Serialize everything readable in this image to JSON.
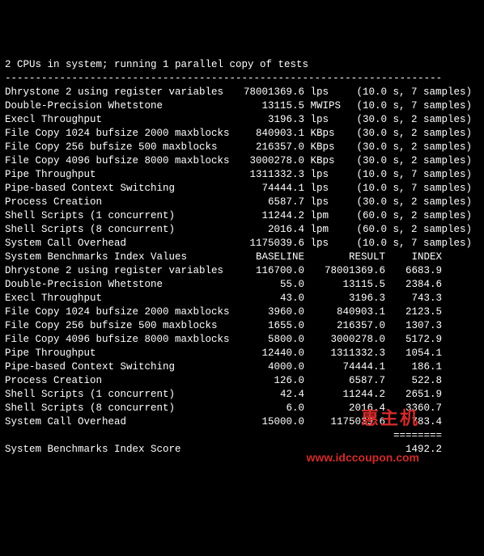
{
  "header": "2 CPUs in system; running 1 parallel copy of tests",
  "dashes": "------------------------------------------------------------------------",
  "tests": [
    {
      "name": "Dhrystone 2 using register variables",
      "value": "78001369.6",
      "unit": "lps",
      "timing": "(10.0 s, 7 samples)"
    },
    {
      "name": "Double-Precision Whetstone",
      "value": "13115.5",
      "unit": "MWIPS",
      "timing": "(10.0 s, 7 samples)"
    },
    {
      "name": "Execl Throughput",
      "value": "3196.3",
      "unit": "lps",
      "timing": "(30.0 s, 2 samples)"
    },
    {
      "name": "File Copy 1024 bufsize 2000 maxblocks",
      "value": "840903.1",
      "unit": "KBps",
      "timing": "(30.0 s, 2 samples)"
    },
    {
      "name": "File Copy 256 bufsize 500 maxblocks",
      "value": "216357.0",
      "unit": "KBps",
      "timing": "(30.0 s, 2 samples)"
    },
    {
      "name": "File Copy 4096 bufsize 8000 maxblocks",
      "value": "3000278.0",
      "unit": "KBps",
      "timing": "(30.0 s, 2 samples)"
    },
    {
      "name": "Pipe Throughput",
      "value": "1311332.3",
      "unit": "lps",
      "timing": "(10.0 s, 7 samples)"
    },
    {
      "name": "Pipe-based Context Switching",
      "value": "74444.1",
      "unit": "lps",
      "timing": "(10.0 s, 7 samples)"
    },
    {
      "name": "Process Creation",
      "value": "6587.7",
      "unit": "lps",
      "timing": "(30.0 s, 2 samples)"
    },
    {
      "name": "Shell Scripts (1 concurrent)",
      "value": "11244.2",
      "unit": "lpm",
      "timing": "(60.0 s, 2 samples)"
    },
    {
      "name": "Shell Scripts (8 concurrent)",
      "value": "2016.4",
      "unit": "lpm",
      "timing": "(60.0 s, 2 samples)"
    },
    {
      "name": "System Call Overhead",
      "value": "1175039.6",
      "unit": "lps",
      "timing": "(10.0 s, 7 samples)"
    }
  ],
  "index_header": {
    "name": "System Benchmarks Index Values",
    "baseline": "BASELINE",
    "result": "RESULT",
    "index": "INDEX"
  },
  "index": [
    {
      "name": "Dhrystone 2 using register variables",
      "baseline": "116700.0",
      "result": "78001369.6",
      "index": "6683.9"
    },
    {
      "name": "Double-Precision Whetstone",
      "baseline": "55.0",
      "result": "13115.5",
      "index": "2384.6"
    },
    {
      "name": "Execl Throughput",
      "baseline": "43.0",
      "result": "3196.3",
      "index": "743.3"
    },
    {
      "name": "File Copy 1024 bufsize 2000 maxblocks",
      "baseline": "3960.0",
      "result": "840903.1",
      "index": "2123.5"
    },
    {
      "name": "File Copy 256 bufsize 500 maxblocks",
      "baseline": "1655.0",
      "result": "216357.0",
      "index": "1307.3"
    },
    {
      "name": "File Copy 4096 bufsize 8000 maxblocks",
      "baseline": "5800.0",
      "result": "3000278.0",
      "index": "5172.9"
    },
    {
      "name": "Pipe Throughput",
      "baseline": "12440.0",
      "result": "1311332.3",
      "index": "1054.1"
    },
    {
      "name": "Pipe-based Context Switching",
      "baseline": "4000.0",
      "result": "74444.1",
      "index": "186.1"
    },
    {
      "name": "Process Creation",
      "baseline": "126.0",
      "result": "6587.7",
      "index": "522.8"
    },
    {
      "name": "Shell Scripts (1 concurrent)",
      "baseline": "42.4",
      "result": "11244.2",
      "index": "2651.9"
    },
    {
      "name": "Shell Scripts (8 concurrent)",
      "baseline": "6.0",
      "result": "2016.4",
      "index": "3360.7"
    },
    {
      "name": "System Call Overhead",
      "baseline": "15000.0",
      "result": "1175039.6",
      "index": "783.4"
    }
  ],
  "sep": "========",
  "score_label": "System Benchmarks Index Score",
  "score_value": "1492.2",
  "watermark": {
    "line1": "惠主机",
    "line2": "www.idccoupon.com"
  }
}
